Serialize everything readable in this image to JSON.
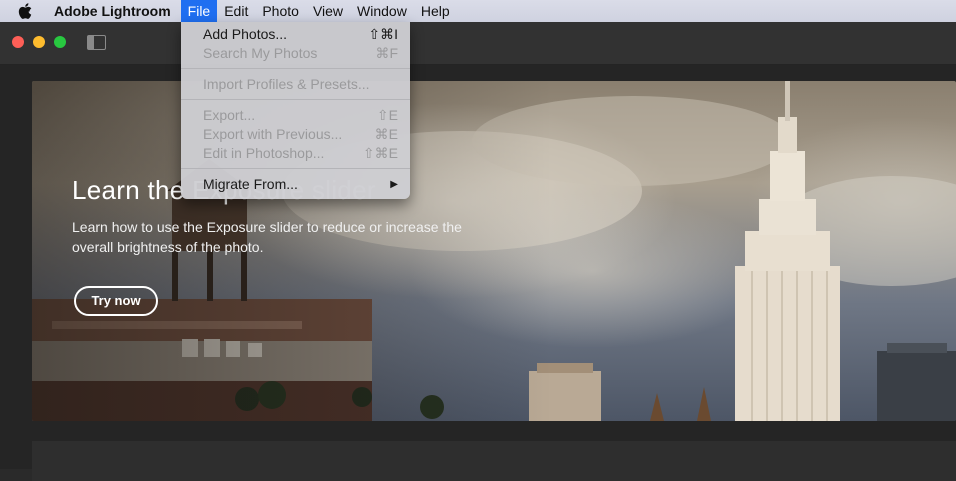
{
  "menubar": {
    "app_name": "Adobe Lightroom",
    "items": [
      "File",
      "Edit",
      "Photo",
      "View",
      "Window",
      "Help"
    ]
  },
  "hero": {
    "title": "Learn the Exposure slider",
    "description": "Learn how to use the Exposure slider to reduce or increase the overall brightness of the photo.",
    "button_label": "Try now"
  },
  "file_menu": {
    "items": [
      {
        "label": "Add Photos...",
        "shortcut": "⇧⌘I",
        "enabled": true
      },
      {
        "label": "Search My Photos",
        "shortcut": "⌘F",
        "enabled": false
      },
      {
        "label": "Import Profiles & Presets...",
        "shortcut": "",
        "enabled": false
      },
      {
        "label": "Export...",
        "shortcut": "⇧E",
        "enabled": false
      },
      {
        "label": "Export with Previous...",
        "shortcut": "⌘E",
        "enabled": false
      },
      {
        "label": "Edit in Photoshop...",
        "shortcut": "⇧⌘E",
        "enabled": false
      },
      {
        "label": "Migrate From...",
        "shortcut": "",
        "enabled": true
      }
    ]
  },
  "colors": {
    "menu_highlight": "#1f6ff1",
    "close": "#fe5f57",
    "minimize": "#febc2e",
    "maximize": "#28c840"
  }
}
